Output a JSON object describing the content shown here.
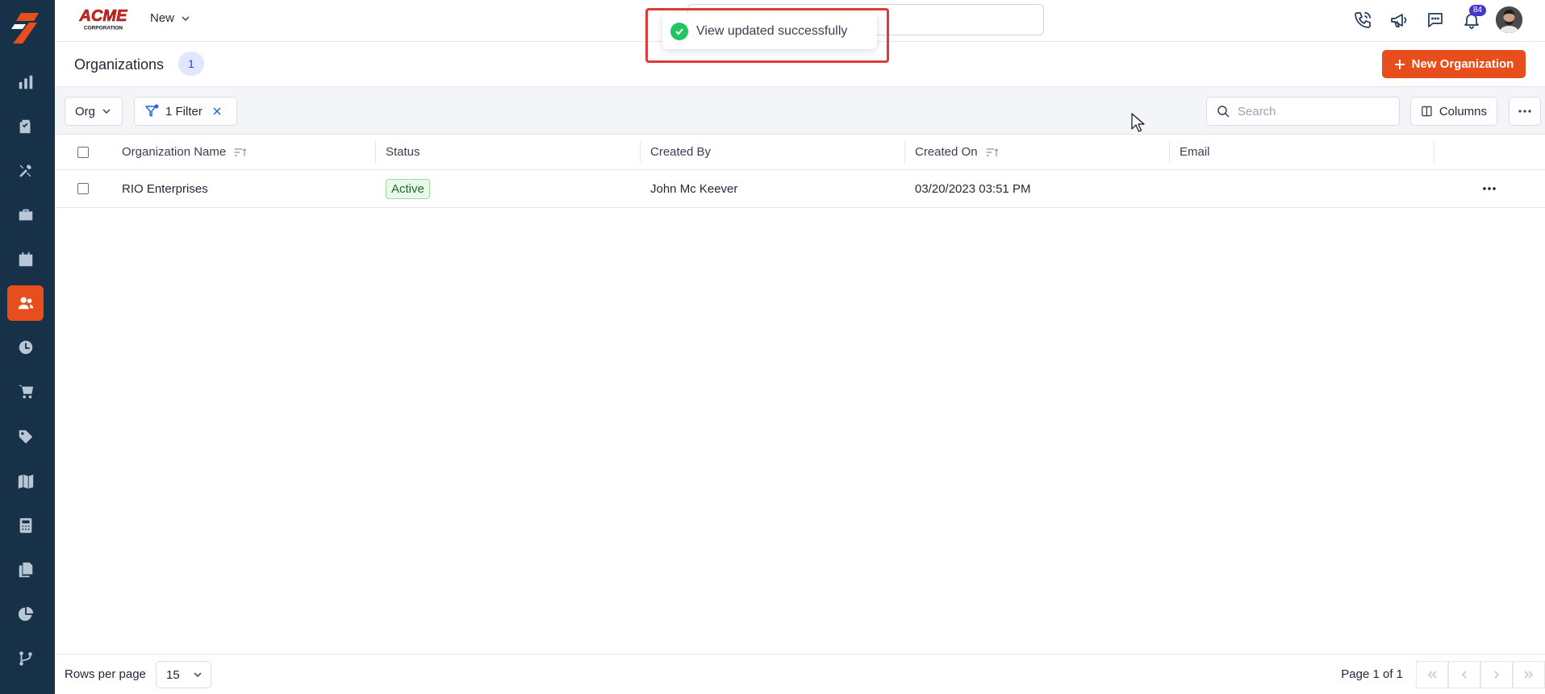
{
  "topbar": {
    "new_label": "New",
    "notification_count": "84"
  },
  "toast": {
    "message": "View updated successfully"
  },
  "header": {
    "title": "Organizations",
    "count": "1",
    "new_button_label": "New Organization"
  },
  "toolbar": {
    "view_label": "Org",
    "filter_label": "1 Filter",
    "search_placeholder": "Search",
    "columns_label": "Columns"
  },
  "table": {
    "columns": [
      "Organization Name",
      "Status",
      "Created By",
      "Created On",
      "Email"
    ],
    "rows": [
      {
        "organization_name": "RIO Enterprises",
        "status": "Active",
        "created_by": "John Mc Keever",
        "created_on": "03/20/2023 03:51 PM",
        "email": ""
      }
    ]
  },
  "footer": {
    "rows_per_page_label": "Rows per page",
    "rows_per_page_value": "15",
    "page_info": "Page 1 of 1"
  },
  "colors": {
    "accent": "#e84e1b",
    "rail": "#163148",
    "toast_outline": "#de3a3a"
  }
}
